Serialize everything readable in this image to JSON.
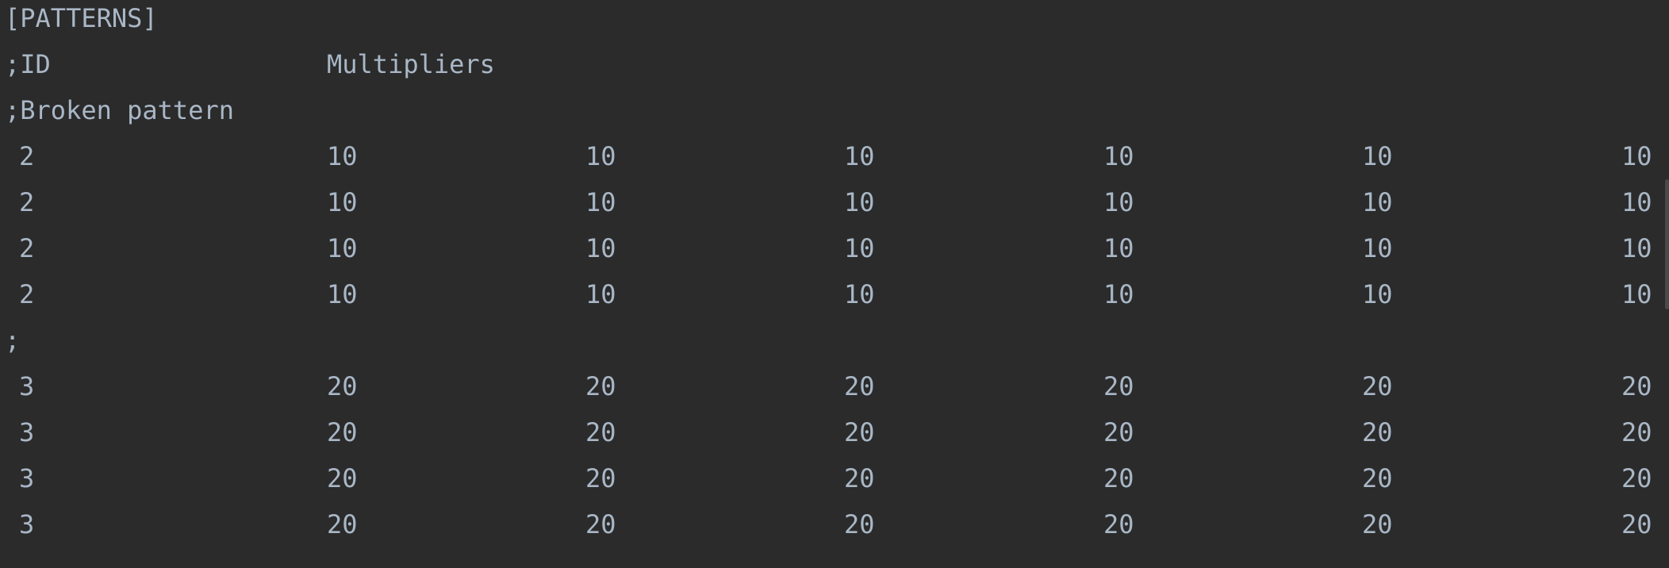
{
  "editor": {
    "header": "[PATTERNS]",
    "comment_id": ";ID",
    "comment_multipliers": "Multipliers",
    "comment_broken": ";Broken pattern",
    "separator": ";",
    "block1": [
      [
        "2",
        "10",
        "10",
        "10",
        "10",
        "10",
        "10"
      ],
      [
        "2",
        "10",
        "10",
        "10",
        "10",
        "10",
        "10"
      ],
      [
        "2",
        "10",
        "10",
        "10",
        "10",
        "10",
        "10"
      ],
      [
        "2",
        "10",
        "10",
        "10",
        "10",
        "10",
        "10"
      ]
    ],
    "block2": [
      [
        "3",
        "20",
        "20",
        "20",
        "20",
        "20",
        "20"
      ],
      [
        "3",
        "20",
        "20",
        "20",
        "20",
        "20",
        "20"
      ],
      [
        "3",
        "20",
        "20",
        "20",
        "20",
        "20",
        "20"
      ],
      [
        "3",
        "20",
        "20",
        "20",
        "20",
        "20",
        "20"
      ]
    ]
  }
}
